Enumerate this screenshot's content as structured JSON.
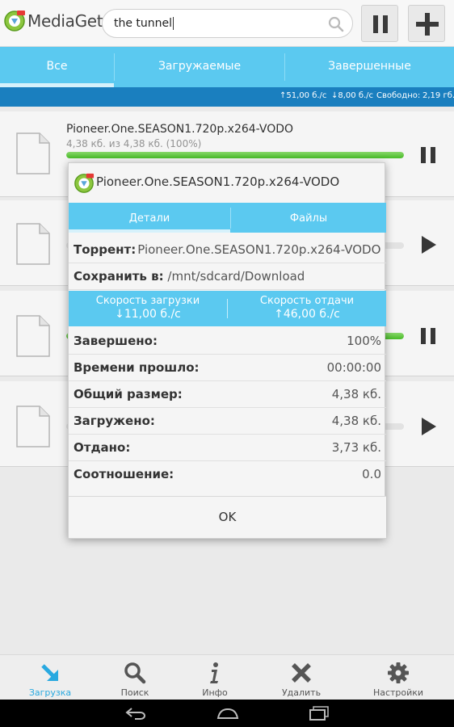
{
  "app": {
    "name": "MediaGet"
  },
  "search": {
    "value": "the tunnel"
  },
  "toolbar": {
    "pause_icon": "pause-icon",
    "add_icon": "plus-icon"
  },
  "tabs": [
    {
      "label": "Все"
    },
    {
      "label": "Загружаемые"
    },
    {
      "label": "Завершенные"
    }
  ],
  "status": {
    "upload_speed": "51,00 б./с",
    "download_speed": "8,00 б./с",
    "free_label": "Свободно:",
    "free_value": "2,19 гб."
  },
  "downloads": [
    {
      "title": "Pioneer.One.SEASON1.720p.x264-VODO",
      "subtitle": "4,38 кб. из 4,38 кб. (100%)",
      "progress": 1.0,
      "state": "pause"
    },
    {
      "title": "",
      "subtitle": "",
      "progress": 0.0,
      "state": "play"
    },
    {
      "title": "",
      "subtitle": "",
      "progress": 1.0,
      "state": "pause"
    },
    {
      "title": "",
      "subtitle": "",
      "progress": 0.0,
      "state": "play"
    }
  ],
  "dialog": {
    "title": "Pioneer.One.SEASON1.720p.x264-VODO",
    "tabs": [
      {
        "label": "Детали"
      },
      {
        "label": "Файлы"
      }
    ],
    "torrent_label": "Торрент:",
    "torrent_value": "Pioneer.One.SEASON1.720p.x264-VODO",
    "save_label": "Сохранить в:",
    "save_value": "/mnt/sdcard/Download",
    "download_speed_label": "Скорость загрузки",
    "download_speed_value": "11,00 б./с",
    "upload_speed_label": "Скорость отдачи",
    "upload_speed_value": "46,00 б./с",
    "stats": [
      {
        "label": "Завершено:",
        "value": "100%"
      },
      {
        "label": "Времени прошло:",
        "value": "00:00:00"
      },
      {
        "label": "Общий размер:",
        "value": "4,38 кб."
      },
      {
        "label": "Загружено:",
        "value": "4,38 кб."
      },
      {
        "label": "Отдано:",
        "value": "3,73 кб."
      },
      {
        "label": "Соотношение:",
        "value": "0.0"
      }
    ],
    "ok_label": "OK"
  },
  "bottom_nav": [
    {
      "label": "Загрузка",
      "icon": "download-arrow-icon",
      "active": true
    },
    {
      "label": "Поиск",
      "icon": "search-icon",
      "active": false
    },
    {
      "label": "Инфо",
      "icon": "info-icon",
      "active": false
    },
    {
      "label": "Удалить",
      "icon": "delete-x-icon",
      "active": false
    },
    {
      "label": "Настройки",
      "icon": "gear-icon",
      "active": false
    }
  ],
  "colors": {
    "accent": "#5bc9f0",
    "status_bar": "#1a7fbf",
    "progress": "#4bc42a",
    "active_nav": "#29a9e0"
  }
}
